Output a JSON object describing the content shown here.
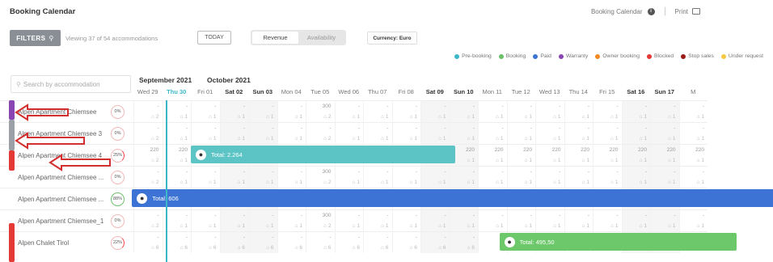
{
  "header": {
    "title": "Booking Calendar",
    "link_calendar": "Booking Calendar",
    "link_print": "Print"
  },
  "toolbar": {
    "filters_label": "FILTERS",
    "viewing_text": "Viewing 37 of 54 accommodations",
    "today_label": "TODAY",
    "view_toggle": [
      "Revenue",
      "Availability"
    ],
    "active_view": "Revenue",
    "currency_label": "Currency: Euro"
  },
  "legend": [
    {
      "label": "Pre-booking",
      "color": "#3bb7c8"
    },
    {
      "label": "Booking",
      "color": "#6cc06a"
    },
    {
      "label": "Paid",
      "color": "#3c73d4"
    },
    {
      "label": "Warranty",
      "color": "#8a45b5"
    },
    {
      "label": "Owner booking",
      "color": "#f08a24"
    },
    {
      "label": "Blocked",
      "color": "#e53935"
    },
    {
      "label": "Stop sales",
      "color": "#9b1b1b"
    },
    {
      "label": "Under request",
      "color": "#f5c842"
    }
  ],
  "search": {
    "placeholder": "Search by accommodation"
  },
  "months": [
    {
      "label": "September 2021"
    },
    {
      "label": "October 2021"
    }
  ],
  "days": [
    {
      "label": "Wed 29",
      "weekend": false
    },
    {
      "label": "Thu 30",
      "weekend": false,
      "today": true
    },
    {
      "label": "Fri 01",
      "weekend": false
    },
    {
      "label": "Sat 02",
      "weekend": true
    },
    {
      "label": "Sun 03",
      "weekend": true
    },
    {
      "label": "Mon 04",
      "weekend": false
    },
    {
      "label": "Tue 05",
      "weekend": false
    },
    {
      "label": "Wed 06",
      "weekend": false
    },
    {
      "label": "Thu 07",
      "weekend": false
    },
    {
      "label": "Fri 08",
      "weekend": false
    },
    {
      "label": "Sat 09",
      "weekend": true
    },
    {
      "label": "Sun 10",
      "weekend": true
    },
    {
      "label": "Mon 11",
      "weekend": false
    },
    {
      "label": "Tue 12",
      "weekend": false
    },
    {
      "label": "Wed 13",
      "weekend": false
    },
    {
      "label": "Thu 14",
      "weekend": false
    },
    {
      "label": "Fri 15",
      "weekend": false
    },
    {
      "label": "Sat 16",
      "weekend": true
    },
    {
      "label": "Sun 17",
      "weekend": true
    },
    {
      "label": "M",
      "weekend": false
    }
  ],
  "rows": [
    {
      "name": "Alpen Apartment Chiemsee",
      "pct": "0%",
      "ring": "pink",
      "avail": "2",
      "prices": [
        "-",
        "-",
        "-",
        "-",
        "-",
        "-",
        "300",
        "-",
        "-",
        "-",
        "-",
        "-",
        "-",
        "-",
        "-",
        "-",
        "-",
        "-",
        "-",
        "-"
      ],
      "avails": [
        "2",
        "1",
        "1",
        "1",
        "1",
        "1",
        "2",
        "1",
        "1",
        "1",
        "1",
        "1",
        "1",
        "1",
        "1",
        "1",
        "1",
        "1",
        "1",
        "1"
      ]
    },
    {
      "name": "Alpen Apartment Chiemsee 3",
      "pct": "0%",
      "ring": "pink",
      "prices": [
        "-",
        "-",
        "-",
        "-",
        "-",
        "-",
        "-",
        "-",
        "-",
        "-",
        "-",
        "-",
        "-",
        "-",
        "-",
        "-",
        "-",
        "-",
        "-",
        "-"
      ],
      "avails": [
        "2",
        "1",
        "1",
        "1",
        "1",
        "1",
        "2",
        "1",
        "1",
        "1",
        "1",
        "1",
        "1",
        "1",
        "1",
        "1",
        "1",
        "1",
        "1",
        "1"
      ]
    },
    {
      "name": "Alpen Apartment Chiemsee 4",
      "pct": "25%",
      "ring": "red",
      "prices": [
        "220",
        "220",
        "",
        "",
        "",
        "",
        "",
        "",
        "",
        "",
        "220",
        "220",
        "220",
        "220",
        "220",
        "220",
        "220",
        "220",
        "220",
        "220"
      ],
      "avails": [
        "2",
        "1",
        "",
        "",
        "",
        "",
        "",
        "",
        "",
        "",
        "1",
        "1",
        "1",
        "1",
        "1",
        "1",
        "1",
        "1",
        "1",
        "1"
      ]
    },
    {
      "name": "Alpen Apartment Chiemsee ...",
      "pct": "0%",
      "ring": "pink",
      "prices": [
        "-",
        "-",
        "-",
        "-",
        "-",
        "-",
        "300",
        "-",
        "-",
        "-",
        "-",
        "-",
        "-",
        "-",
        "-",
        "-",
        "-",
        "-",
        "-",
        "-"
      ],
      "avails": [
        "2",
        "1",
        "1",
        "1",
        "1",
        "1",
        "2",
        "1",
        "1",
        "1",
        "1",
        "1",
        "1",
        "1",
        "1",
        "1",
        "1",
        "1",
        "1",
        "1"
      ]
    },
    {
      "name": "Alpen Apartment Chiemsee ...",
      "pct": "88%",
      "ring": "green",
      "prices": [],
      "avails": []
    },
    {
      "name": "Alpen Apartment Chiemsee_1",
      "pct": "0%",
      "ring": "pink",
      "prices": [
        "-",
        "-",
        "-",
        "-",
        "-",
        "-",
        "300",
        "-",
        "-",
        "-",
        "-",
        "-",
        "-",
        "-",
        "-",
        "-",
        "-",
        "-",
        "-",
        "-"
      ],
      "avails": [
        "2",
        "1",
        "1",
        "1",
        "1",
        "1",
        "2",
        "1",
        "1",
        "1",
        "1",
        "1",
        "1",
        "1",
        "1",
        "1",
        "1",
        "1",
        "1",
        "1"
      ]
    },
    {
      "name": "Alpen Chalet Tirol",
      "pct": "22%",
      "ring": "red",
      "prices": [
        "-",
        "-",
        "-",
        "-",
        "-",
        "-",
        "-",
        "-",
        "-",
        "-",
        "-",
        "-",
        "",
        "",
        "",
        "",
        "",
        "",
        "",
        ""
      ],
      "avails": [
        "6",
        "6",
        "6",
        "6",
        "6",
        "6",
        "6",
        "6",
        "6",
        "6",
        "6",
        "6",
        "",
        "",
        "",
        "",
        "",
        "",
        "",
        ""
      ]
    }
  ],
  "bookings": [
    {
      "row": 2,
      "start": 2,
      "span": 9.2,
      "total": "Total: 2.264",
      "color": "#5cc4c4"
    },
    {
      "row": 4,
      "start": -0.05,
      "span": 22.4,
      "total": "Total: 606",
      "color": "#3c73d4"
    },
    {
      "row": 6,
      "start": 12.75,
      "span": 8.25,
      "total": "Total: 495,50",
      "color": "#6cc86a"
    }
  ],
  "side_markers": [
    {
      "color": "#8a45b5"
    },
    {
      "color": "#9aa0a6"
    },
    {
      "color": "#e53935"
    },
    {
      "color": "#e53935"
    }
  ]
}
